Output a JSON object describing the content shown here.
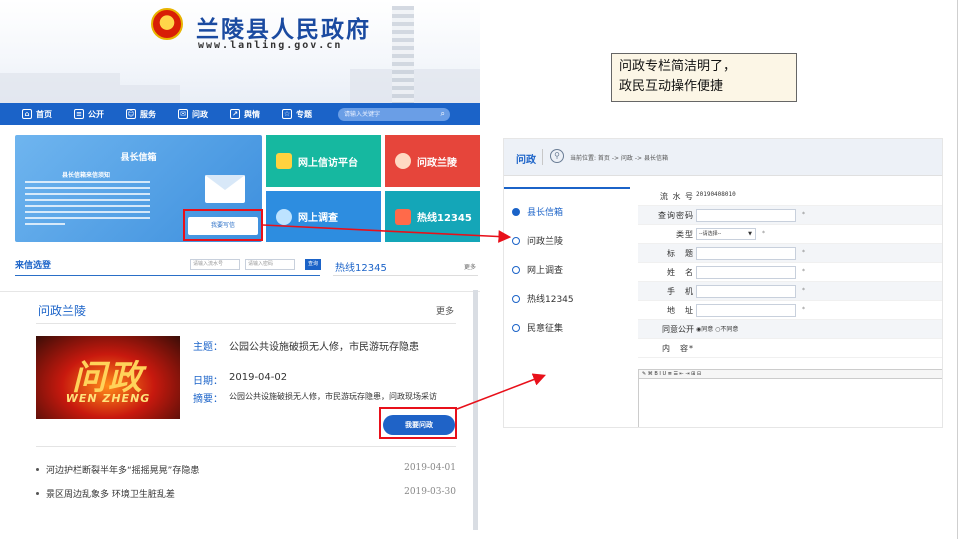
{
  "site": {
    "title": "兰陵县人民政府",
    "url": "www.lanling.gov.cn",
    "nav": [
      "首页",
      "公开",
      "服务",
      "问政",
      "舆情",
      "专题"
    ],
    "nav_icons": [
      "home-icon",
      "document-icon",
      "service-icon",
      "chat-icon",
      "trend-icon",
      "star-icon"
    ],
    "search_placeholder": "请输入关键字"
  },
  "mayor_box": {
    "title": "县长信箱",
    "subtitle": "县长信箱来信须知",
    "write_button": "我要写信"
  },
  "tiles": {
    "petition": "网上信访平台",
    "wz": "问政兰陵",
    "survey": "网上调查",
    "hotline": "热线12345"
  },
  "letter_query": {
    "title": "来信选登",
    "serial_placeholder": "请输入流水号",
    "password_placeholder": "请输入密码",
    "query_button": "查询"
  },
  "hotline_panel": {
    "title": "热线12345",
    "more": "更多"
  },
  "wz_panel": {
    "title": "问政兰陵",
    "more": "更多",
    "thumb_big": "问政",
    "thumb_small": "WEN ZHENG",
    "subject_label": "主题：",
    "subject": "公园公共设施破损无人修，市民游玩存隐患",
    "date_label": "日期：",
    "date": "2019-04-02",
    "summary_label": "摘要：",
    "summary": "公园公共设施破损无人修，市民游玩存隐患，问政现场采访",
    "ask_button": "我要问政",
    "news": [
      {
        "title": "河边护栏断裂半年多“摇摇晃晃”存隐患",
        "date": "2019-04-01"
      },
      {
        "title": "景区周边乱象多 环境卫生脏乱差",
        "date": "2019-03-30"
      }
    ]
  },
  "caption": {
    "line1": "问政专栏简洁明了，",
    "line2": "政民互动操作便捷"
  },
  "form": {
    "section": "问政",
    "breadcrumb": "当前位置: 首页 -> 问政 -> 县长信箱",
    "side_menu": [
      "县长信箱",
      "问政兰陵",
      "网上调查",
      "热线12345",
      "民意征集"
    ],
    "active_index": 0,
    "fields": {
      "serial_label": "流 水 号",
      "serial_value": "20190408010",
      "password_label": "查询密码",
      "type_label": "类型",
      "type_value": "--请选择--",
      "title_label": "标　题",
      "name_label": "姓　名",
      "phone_label": "手　机",
      "address_label": "地　址",
      "public_label": "同意公开",
      "public_options": "◉同意 ○不同意",
      "content_label": "内　容*",
      "editor_toolbar": "✎ ⌘ B I U ≣ ☰ ⇤ ⇥ ⊞ ⊟"
    },
    "required_mark": "*"
  },
  "colors": {
    "brand_blue": "#1b63c8",
    "highlight_red": "#e8101a"
  }
}
